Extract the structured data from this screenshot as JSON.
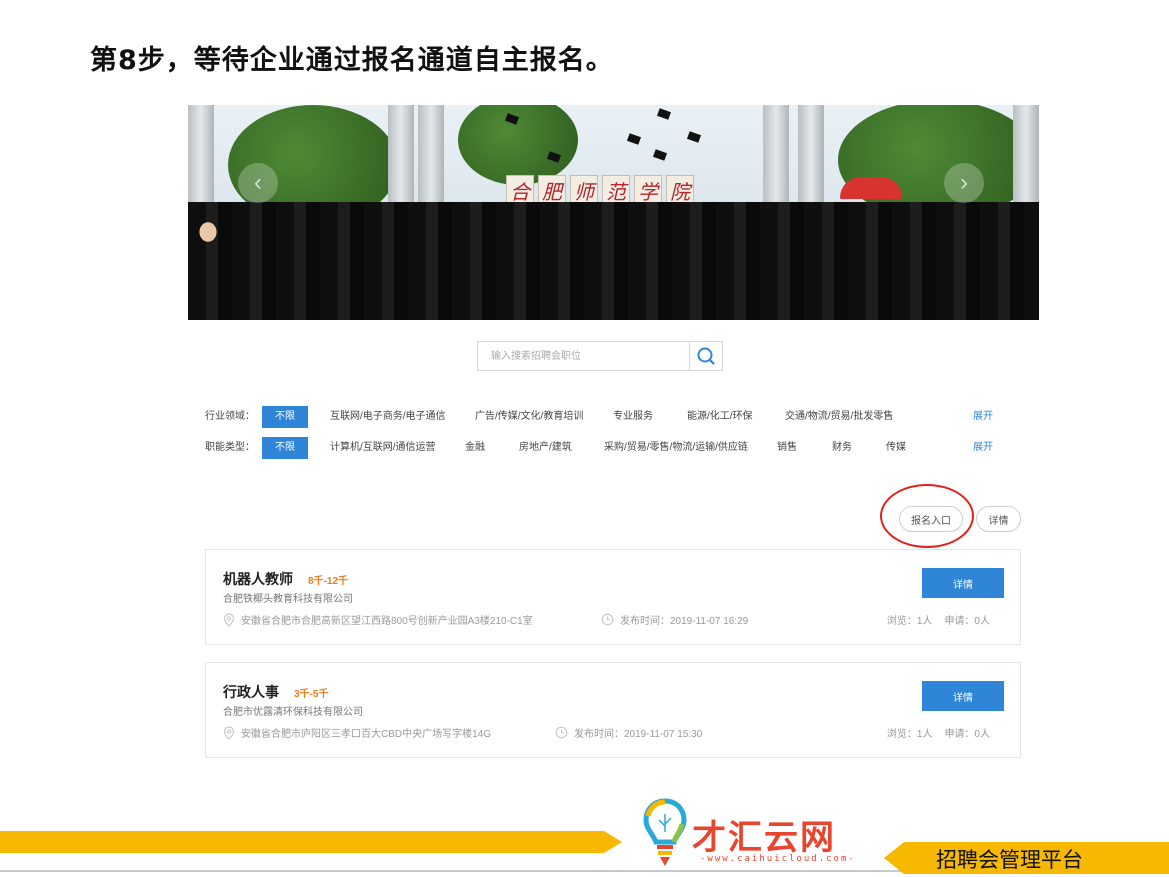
{
  "slide": {
    "title": "第8步，等待企业通过报名通道自主报名。"
  },
  "banner": {
    "sign_chars": [
      "合",
      "肥",
      "师",
      "范",
      "学",
      "院"
    ]
  },
  "search": {
    "placeholder": "输入搜索招聘会职位"
  },
  "filters": {
    "industry": {
      "label": "行业领域：",
      "all": "不限",
      "options": [
        "互联网/电子商务/电子通信",
        "广告/传媒/文化/教育培训",
        "专业服务",
        "能源/化工/环保",
        "交通/物流/贸易/批发零售"
      ],
      "expand": "展开"
    },
    "function": {
      "label": "职能类型：",
      "all": "不限",
      "options": [
        "计算机/互联网/通信运营",
        "金融",
        "房地产/建筑",
        "采购/贸易/零售/物流/运输/供应链",
        "销售",
        "财务",
        "传媒"
      ],
      "expand": "展开"
    }
  },
  "actions": {
    "register": "报名入口",
    "details": "详情"
  },
  "jobs": [
    {
      "title": "机器人教师",
      "salary": "8千-12千",
      "company": "合肥铁椰头教育科技有限公司",
      "address": "安徽省合肥市合肥高新区望江西路800号创新产业园A3楼210-C1室",
      "publish": "发布时间：2019-11-07 16:29",
      "views": "浏览：1人",
      "applies": "申请：0人",
      "button": "详情"
    },
    {
      "title": "行政人事",
      "salary": "3千-5千",
      "company": "合肥市优露清环保科技有限公司",
      "address": "安徽省合肥市庐阳区三孝口百大CBD中央广场写字楼14G",
      "publish": "发布时间：2019-11-07 15:30",
      "views": "浏览：1人",
      "applies": "申请：0人",
      "button": "详情"
    }
  ],
  "footer": {
    "brand": "才汇云网",
    "url": "-www.caihuicloud.com-",
    "platform": "招聘会管理平台"
  },
  "colors": {
    "accent": "#2f86d9",
    "salary": "#f07a1a",
    "highlight": "#e2231a",
    "footer_bar": "#f6b800",
    "brand": "#e8452f"
  }
}
